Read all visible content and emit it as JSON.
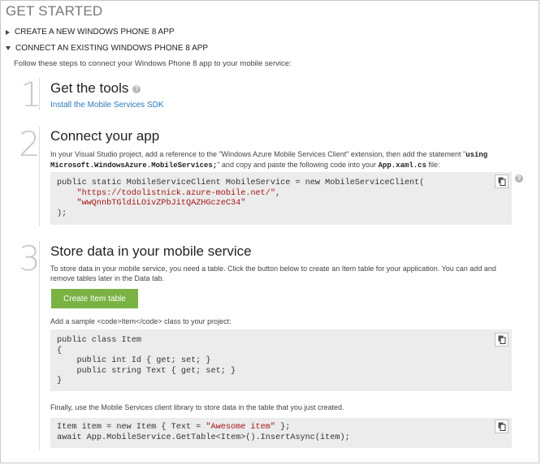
{
  "page_title": "GET STARTED",
  "sections": [
    {
      "label": "CREATE A NEW WINDOWS PHONE 8 APP",
      "expanded": false
    },
    {
      "label": "CONNECT AN EXISTING WINDOWS PHONE 8 APP",
      "expanded": true
    }
  ],
  "intro": "Follow these steps to connect your Windows Phone 8 app to your mobile service:",
  "step1": {
    "number": "1",
    "title": "Get the tools",
    "help_glyph": "?",
    "link": "Install the Mobile Services SDK"
  },
  "step2": {
    "number": "2",
    "title": "Connect your app",
    "text_a": "In your Visual Studio project, add a reference to the \"Windows Azure Mobile Services Client\" extension, then add the statement \"",
    "text_code1": "using",
    "text_code2": "Microsoft.WindowsAzure.MobileServices;",
    "text_b": "\" and copy and paste the following code into your ",
    "text_code3": "App.xaml.cs",
    "text_c": " file:",
    "code_line1": "public static MobileServiceClient MobileService = new MobileServiceClient(",
    "code_url": "\"https://todolistnick.azure-mobile.net/\"",
    "code_comma": ",",
    "code_key": "\"wwQnnbTGldiLOivZPbJitQAZHGczeC34\"",
    "code_close": ");",
    "help_glyph": "?"
  },
  "step3": {
    "number": "3",
    "title": "Store data in your mobile service",
    "text1": "To store data in your mobile service, you need a table. Click the button below to create an Item table for your application. You can add and remove tables later in the Data tab.",
    "button": "Create Item table",
    "text2": "Add a sample <code>Item</code> class to your project:",
    "class_code": "public class Item\n{\n    public int Id { get; set; }\n    public string Text { get; set; }\n}",
    "text3": "Finally, use the Mobile Services client library to store data in the table that you just created.",
    "insert_code1_a": "Item item = new Item { Text = ",
    "insert_code1_str": "\"Awesome item\"",
    "insert_code1_b": " };",
    "insert_code2": "await App.MobileService.GetTable<Item>().InsertAsync(item);"
  }
}
